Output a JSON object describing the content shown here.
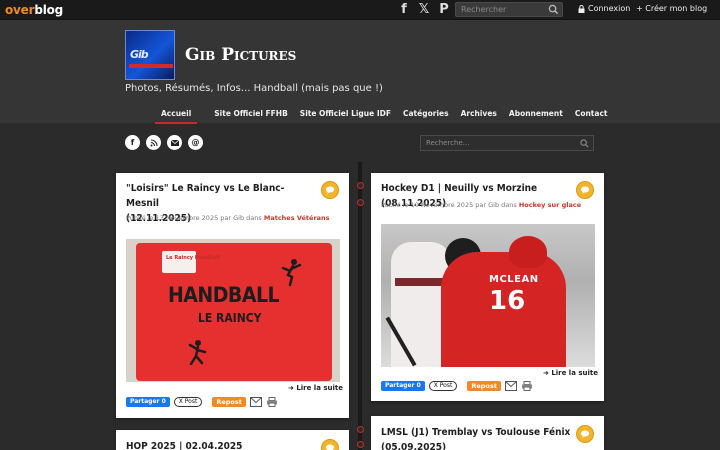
{
  "overblog": {
    "logo_over": "over",
    "logo_blog": "blog",
    "social": [
      "facebook-icon",
      "x-icon",
      "pinterest-icon"
    ],
    "search_placeholder": "Rechercher",
    "login_label": "Connexion",
    "create_label": "+ Créer mon blog"
  },
  "site": {
    "logo_text": "Gib",
    "title": "Gib Pictures",
    "description": "Photos, Résumés, Infos... Handball (mais pas que !)"
  },
  "nav": {
    "items": [
      {
        "label": "Accueil",
        "active": true
      },
      {
        "label": "Site Officiel FFHB"
      },
      {
        "label": "Site Officiel Ligue IDF"
      },
      {
        "label": "Catégories"
      },
      {
        "label": "Archives"
      },
      {
        "label": "Abonnement"
      },
      {
        "label": "Contact"
      }
    ]
  },
  "share_icons": [
    "facebook-icon",
    "rss-icon",
    "mail-icon",
    "at-icon"
  ],
  "blog_search_placeholder": "Recherche...",
  "posts": [
    {
      "title_line1": "\"Loisirs\" Le Raincy vs Le Blanc-Mesnil",
      "title_line2": "(12.11.2025)",
      "meta_prefix": "Publié le 13 Novembre 2025 par Gib dans ",
      "category": "Matches Vétérans",
      "image_word": "HANDBALL",
      "image_sub": "LE RAINCY",
      "image_patch": "Le Raincy Handball",
      "read_more": "Lire la suite",
      "fb_label": "Partager 0",
      "x_label": "X Post",
      "repost_label": "Repost"
    },
    {
      "title_line1": "Hockey D1 | Neuilly vs Morzine (08.11.2025)",
      "meta_prefix": "Publié le 10 Novembre 2025 par Gib dans ",
      "category": "Hockey sur glace",
      "image_name": "MCLEAN",
      "image_number": "16",
      "read_more": "Lire la suite",
      "fb_label": "Partager 0",
      "x_label": "X Post",
      "repost_label": "Repost"
    },
    {
      "title_line1": "HOP 2025 | 02.04.2025"
    },
    {
      "title_line1": "LMSL (J1) Tremblay vs Toulouse Fénix",
      "title_line2": "(05.09.2025)"
    }
  ],
  "colors": {
    "accent": "#f08a24",
    "badge": "#f1b42a",
    "category": "#c0392b",
    "nav_active": "#c62b2b"
  }
}
